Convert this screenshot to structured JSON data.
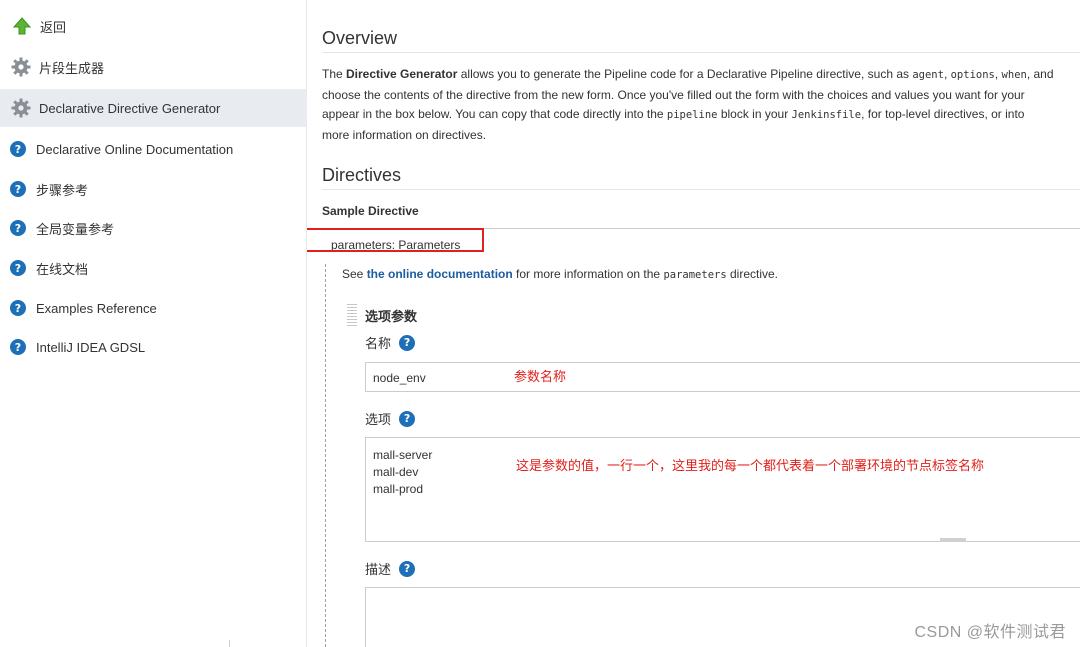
{
  "sidebar": {
    "items": [
      {
        "label": "返回",
        "icon": "up-arrow-icon"
      },
      {
        "label": "片段生成器",
        "icon": "gear-icon"
      },
      {
        "label": "Declarative Directive Generator",
        "icon": "gear-icon"
      },
      {
        "label": "Declarative Online Documentation",
        "icon": "help-icon"
      },
      {
        "label": "步骤参考",
        "icon": "help-icon"
      },
      {
        "label": "全局变量参考",
        "icon": "help-icon"
      },
      {
        "label": "在线文档",
        "icon": "help-icon"
      },
      {
        "label": "Examples Reference",
        "icon": "help-icon"
      },
      {
        "label": "IntelliJ IDEA GDSL",
        "icon": "help-icon"
      }
    ],
    "active_item": "Declarative Directive Generator"
  },
  "overview": {
    "title": "Overview",
    "line1_pre": "The ",
    "line1_bold": "Directive Generator",
    "line1_post": " allows you to generate the Pipeline code for a Declarative Pipeline directive, such as ",
    "line1_code1": "agent",
    "line1_sep1": ", ",
    "line1_code2": "options",
    "line1_sep2": ", ",
    "line1_code3": "when",
    "line1_end": ", and",
    "line2": "choose the contents of the directive from the new form. Once you've filled out the form with the choices and values you want for your",
    "line3_pre": "appear in the box below. You can copy that code directly into the ",
    "line3_code1": "pipeline",
    "line3_mid": " block in your ",
    "line3_code2": "Jenkinsfile",
    "line3_post": ", for top-level directives, or into",
    "line4": "more information on directives."
  },
  "directives": {
    "title": "Directives",
    "sample_label": "Sample Directive",
    "selected_directive": "parameters: Parameters",
    "see_pre": "See ",
    "see_link": "the online documentation",
    "see_mid": " for more information on the ",
    "see_code": "parameters",
    "see_post": " directive."
  },
  "param_form": {
    "section_title": "选项参数",
    "name_label": "名称",
    "name_value": "node_env",
    "choices_label": "选项",
    "choices_value": "mall-server\nmall-dev\nmall-prod",
    "description_label": "描述",
    "description_value": "",
    "help_glyph": "?"
  },
  "annotations": {
    "name_note": "参数名称",
    "choices_note": "这是参数的值，一行一个，这里我的每一个都代表着一个部署环境的节点标签名称"
  },
  "watermark": "CSDN @软件测试君",
  "colors": {
    "accent_blue": "#1d6fb8",
    "link_blue": "#1d5c9f",
    "annotation_red": "#e0201b",
    "active_bg": "#e8ecf1",
    "arrow_green": "#5bb532"
  }
}
